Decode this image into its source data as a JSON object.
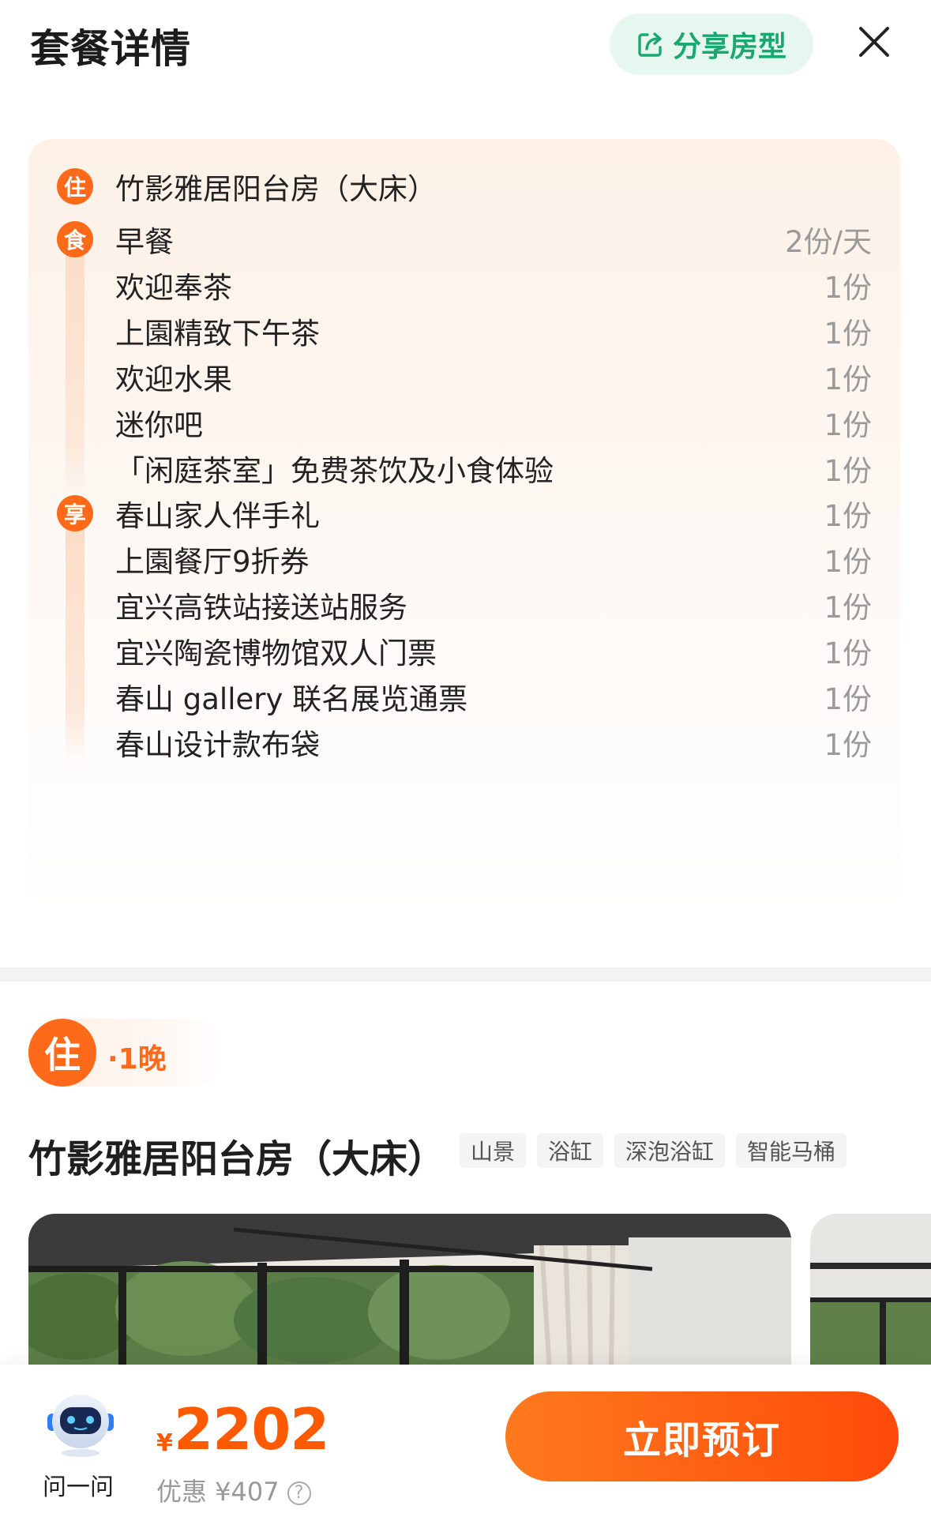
{
  "header": {
    "title": "套餐详情",
    "share_label": "分享房型",
    "close_icon": "close-icon",
    "share_icon": "share-icon"
  },
  "package": {
    "room": {
      "badge": "住",
      "name": "竹影雅居阳台房（大床）"
    },
    "food": {
      "badge": "食",
      "items": [
        {
          "name": "早餐",
          "qty": "2份/天"
        },
        {
          "name": "欢迎奉茶",
          "qty": "1份"
        },
        {
          "name": "上園精致下午茶",
          "qty": "1份"
        },
        {
          "name": "欢迎水果",
          "qty": "1份"
        },
        {
          "name": "迷你吧",
          "qty": "1份"
        },
        {
          "name": "「闲庭茶室」免费茶饮及小食体验",
          "qty": "1份"
        }
      ]
    },
    "enjoy": {
      "badge": "享",
      "items": [
        {
          "name": "春山家人伴手礼",
          "qty": "1份"
        },
        {
          "name": "上園餐厅9折券",
          "qty": "1份"
        },
        {
          "name": "宜兴高铁站接送站服务",
          "qty": "1份"
        },
        {
          "name": "宜兴陶瓷博物馆双人门票",
          "qty": "1份"
        },
        {
          "name": "春山 gallery 联名展览通票",
          "qty": "1份"
        },
        {
          "name": "春山设计款布袋",
          "qty": "1份"
        }
      ]
    }
  },
  "stay": {
    "badge": "住",
    "nights": "·1晚"
  },
  "room_section": {
    "title": "竹影雅居阳台房（大床）",
    "tags": [
      "山景",
      "浴缸",
      "深泡浴缸",
      "智能马桶"
    ]
  },
  "bottom": {
    "assistant_label": "问一问",
    "currency": "¥",
    "price": "2202",
    "discount": "优惠 ¥407",
    "help_icon": "?",
    "book_label": "立即预订"
  },
  "colors": {
    "accent": "#ff6a1a",
    "share_green": "#1aa870",
    "price": "#ff5a00"
  }
}
